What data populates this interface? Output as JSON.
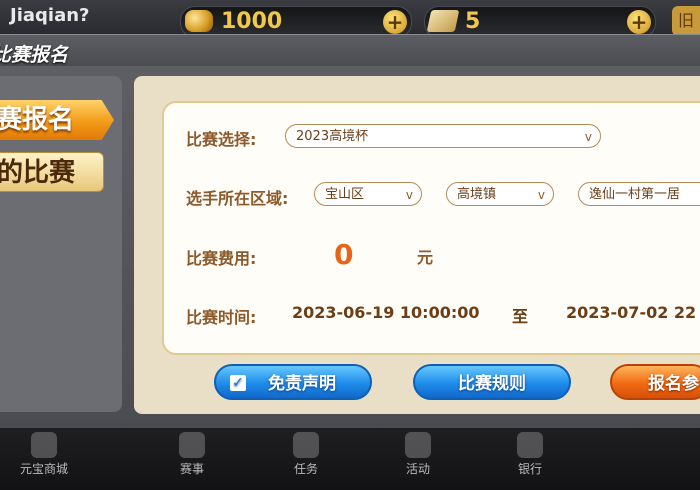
{
  "topbar": {
    "user_name": "Jiaqian?",
    "gold": "1000",
    "cards": "5",
    "plus": "+",
    "right_btn": "旧"
  },
  "window": {
    "title": "比赛报名",
    "tabs": [
      "赛报名",
      "的比赛"
    ]
  },
  "form": {
    "match_label": "比赛选择:",
    "match_value": "2023高境杯",
    "region_label": "选手所在区域:",
    "region_district": "宝山区",
    "region_town": "高境镇",
    "region_village": "逸仙一村第一居",
    "fee_label": "比赛费用:",
    "fee_value": "0",
    "fee_unit": "元",
    "time_label": "比赛时间:",
    "time_start": "2023-06-19 10:00:00",
    "time_to": "至",
    "time_end": "2023-07-02 22",
    "chevron": "v"
  },
  "buttons": {
    "disclaimer": "免责声明",
    "rules": "比赛规则",
    "signup": "报名参"
  },
  "nav": [
    "元宝商城",
    "赛事",
    "任务",
    "活动",
    "银行"
  ]
}
